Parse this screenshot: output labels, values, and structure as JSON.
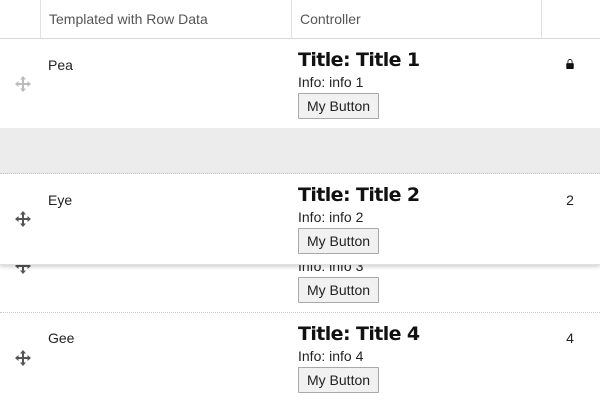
{
  "table": {
    "columns": [
      "",
      "Templated with Row Data",
      "Controller",
      ""
    ],
    "rows": [
      {
        "name": "Pea",
        "title": "Title: Title 1",
        "info": "Info: info 1",
        "button": "My Button",
        "last": "",
        "last_icon": "lock-icon",
        "handle_faded": true
      },
      {
        "name": "Eye",
        "title": "Title: Title 2",
        "info": "Info: info 2",
        "button": "My Button",
        "last": "2",
        "dragging": true
      },
      {
        "name": "",
        "title": "",
        "info": "Info: info 3",
        "button": "My Button",
        "last": ""
      },
      {
        "name": "Gee",
        "title": "Title: Title 4",
        "info": "Info: info 4",
        "button": "My Button",
        "last": "4"
      }
    ]
  },
  "colors": {
    "placeholder": "#ececec",
    "border": "#d9d9d9"
  }
}
